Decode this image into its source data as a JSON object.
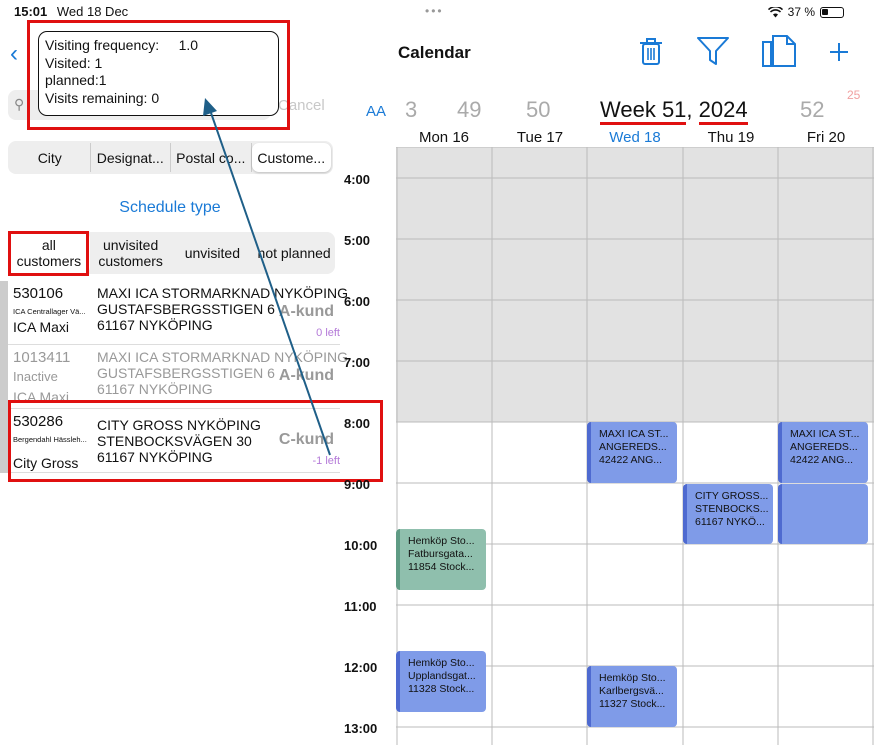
{
  "status_bar": {
    "time": "15:01",
    "date": "Wed 18 Dec",
    "battery": "37 %"
  },
  "search": {
    "cancel_label": "Cancel"
  },
  "filter_tabs": [
    "City",
    "Designat...",
    "Postal co...",
    "Custome..."
  ],
  "schedule_type_label": "Schedule type",
  "schedule_tabs": [
    "all customers",
    "unvisited customers",
    "unvisited",
    "not planned"
  ],
  "customers": [
    {
      "number": "530106",
      "company": "ICA Centrallager Vä...",
      "chain": "ICA Maxi",
      "name": "MAXI ICA STORMARKNAD NYKÖPING",
      "street": "GUSTAFSBERGSSTIGEN 6",
      "postal": "61167 NYKÖPING",
      "class": "A-kund",
      "left": "0 left"
    },
    {
      "number": "1013411",
      "company": "Inactive",
      "chain": "ICA Maxi",
      "name": "MAXI ICA STORMARKNAD NYKÖPING",
      "street": "GUSTAFSBERGSSTIGEN 6",
      "postal": "61167 NYKÖPING",
      "class": "A-kund",
      "left": ""
    },
    {
      "number": "530286",
      "company": "Bergendahl Hässleh...",
      "chain": "City Gross",
      "name": "CITY GROSS NYKÖPING",
      "street": "STENBOCKSVÄGEN 30",
      "postal": "61167 NYKÖPING",
      "class": "C-kund",
      "left": "-1 left"
    }
  ],
  "popup": {
    "frequency_label": "Visiting frequency:",
    "frequency_value": "1.0",
    "visited": "Visited:  1",
    "planned": "planned:1",
    "remaining": "Visits remaining:  0"
  },
  "calendar": {
    "title": "Calendar",
    "aa": "AA",
    "week_numbers": [
      "3",
      "49",
      "50",
      "52"
    ],
    "week_title_a": "Week 51",
    "week_title_sep": ", ",
    "week_title_b": "2024",
    "badge": "25",
    "days": [
      "Mon 16",
      "Tue 17",
      "Wed 18",
      "Thu 19",
      "Fri 20"
    ],
    "hours": [
      "4:00",
      "5:00",
      "6:00",
      "7:00",
      "8:00",
      "9:00",
      "10:00",
      "11:00",
      "12:00",
      "13:00"
    ],
    "events": [
      {
        "day": 2,
        "lines": [
          "MAXI ICA ST...",
          "ANGEREDS...",
          "42422 ANG..."
        ],
        "color": "blue"
      },
      {
        "day": 4,
        "lines": [
          "MAXI ICA ST...",
          "ANGEREDS...",
          "42422 ANG..."
        ],
        "color": "blue"
      },
      {
        "day": 3,
        "lines": [
          "CITY GROSS...",
          "STENBOCKS...",
          "61167 NYKÖ..."
        ],
        "color": "blue"
      },
      {
        "day": 4,
        "lines": [
          "",
          "",
          ""
        ],
        "color": "blue"
      },
      {
        "day": 0,
        "lines": [
          "Hemköp Sto...",
          "Fatbursgata...",
          "11854 Stock..."
        ],
        "color": "green"
      },
      {
        "day": 0,
        "lines": [
          "Hemköp Sto...",
          "Upplandsgat...",
          "11328 Stock..."
        ],
        "color": "blue"
      },
      {
        "day": 2,
        "lines": [
          "Hemköp Sto...",
          "Karlbergsvä...",
          "11327 Stock..."
        ],
        "color": "blue"
      }
    ]
  }
}
